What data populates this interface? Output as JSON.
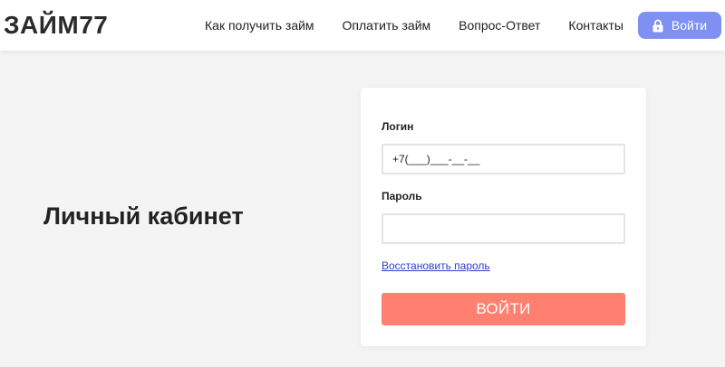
{
  "header": {
    "logo": "ЗАЙМ77",
    "nav": [
      {
        "label": "Как получить займ"
      },
      {
        "label": "Оплатить займ"
      },
      {
        "label": "Вопрос-Ответ"
      },
      {
        "label": "Контакты"
      }
    ],
    "login_button": {
      "label": "Войти",
      "icon": "lock-icon"
    }
  },
  "main": {
    "title": "Личный кабинет"
  },
  "login_form": {
    "login_label": "Логин",
    "login_value": "+7(___)___-__-__",
    "password_label": "Пароль",
    "password_value": "",
    "restore_link": "Восстановить пароль",
    "submit_label": "ВОЙТИ"
  },
  "colors": {
    "accent_button": "#7f90f2",
    "submit_button": "#ff7f70",
    "link": "#2a3fd1",
    "background": "#f4f4f4"
  }
}
